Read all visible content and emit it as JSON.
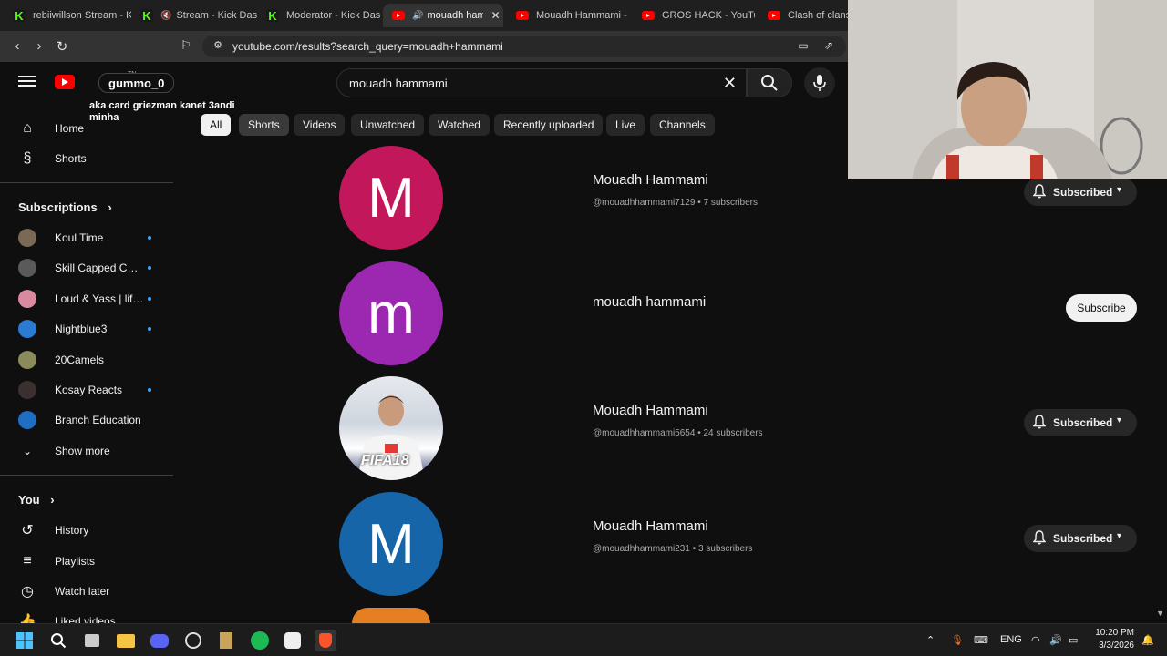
{
  "browser": {
    "tabs": [
      {
        "label": "rebiiwillson Stream - Ki",
        "icon": "kick-icon"
      },
      {
        "label": "Stream - Kick Dash",
        "icon": "kick-icon"
      },
      {
        "label": "Moderator - Kick Dash",
        "icon": "kick-icon"
      },
      {
        "label": "mouadh hamm",
        "icon": "youtube-icon",
        "active": true
      },
      {
        "label": "Mouadh Hammami -",
        "icon": "youtube-icon"
      },
      {
        "label": "GROS HACK - YouTub",
        "icon": "youtube-icon"
      },
      {
        "label": "Clash of clans m",
        "icon": "youtube-icon"
      }
    ],
    "url": "youtube.com/results?search_query=mouadh+hammami"
  },
  "header": {
    "logo_text": "YouTube",
    "country": "TN",
    "search_value": "mouadh hammami"
  },
  "overlay": {
    "username": "gummo_0",
    "message": "aka card griezman kanet 3andi minha"
  },
  "chips": [
    "All",
    "Shorts",
    "Videos",
    "Unwatched",
    "Watched",
    "Recently uploaded",
    "Live",
    "Channels"
  ],
  "sidebar": {
    "home": "Home",
    "shorts": "Shorts",
    "subscriptions_title": "Subscriptions",
    "subscriptions": [
      {
        "label": "Koul Time",
        "color": "#7a6a55",
        "dot": true
      },
      {
        "label": "Skill Capped Cha...",
        "color": "#5a5a5a",
        "dot": true
      },
      {
        "label": "Loud & Yass | life...",
        "color": "#d98aa0",
        "dot": true
      },
      {
        "label": "Nightblue3",
        "color": "#2a7bd1",
        "dot": true
      },
      {
        "label": "20Camels",
        "color": "#8a8a5a",
        "dot": false
      },
      {
        "label": "Kosay Reacts",
        "color": "#3a3030",
        "dot": true
      },
      {
        "label": "Branch Education",
        "color": "#1e6fc4",
        "dot": false
      }
    ],
    "show_more": "Show more",
    "you_title": "You",
    "you_items": [
      "History",
      "Playlists",
      "Watch later",
      "Liked videos"
    ]
  },
  "results": [
    {
      "initial": "M",
      "avatar_color": "#c2185b",
      "name": "Mouadh Hammami",
      "handle": "@mouadhhammami7129",
      "subs": "7 subscribers",
      "button": "Subscribed",
      "subscribed": true
    },
    {
      "initial": "m",
      "avatar_color": "#9c27b0",
      "name": "mouadh hammami",
      "handle": "",
      "subs": "",
      "button": "Subscribe",
      "subscribed": false
    },
    {
      "initial": "",
      "avatar_color": "#d9dde3",
      "name": "Mouadh Hammami",
      "handle": "@mouadhhammami5654",
      "subs": "24 subscribers",
      "button": "Subscribed",
      "subscribed": true,
      "image_caption": "FIFA18"
    },
    {
      "initial": "M",
      "avatar_color": "#1565a8",
      "name": "Mouadh Hammami",
      "handle": "@mouadhhammami231",
      "subs": "3 subscribers",
      "button": "Subscribed",
      "subscribed": true
    }
  ],
  "taskbar": {
    "lang": "ENG",
    "time": "10:20 PM",
    "date": "3/3/2026"
  }
}
